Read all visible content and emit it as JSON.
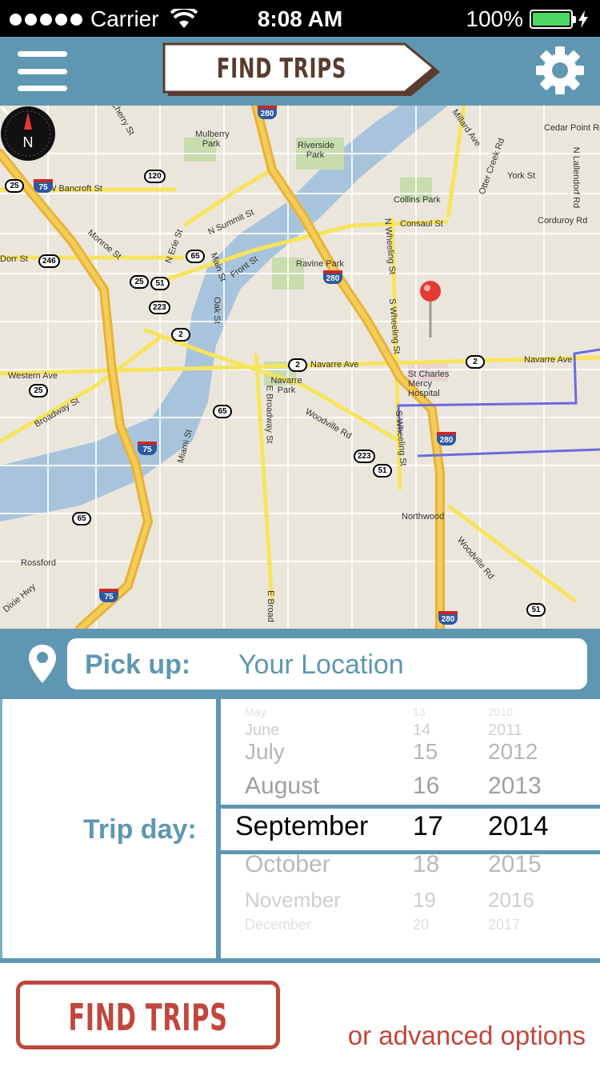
{
  "status_bar": {
    "carrier": "Carrier",
    "time": "8:08 AM",
    "battery": "100%",
    "battery_color": "#4cd964"
  },
  "header": {
    "title": "FIND TRIPS",
    "menu_icon": "hamburger-menu-icon",
    "settings_icon": "gear-icon",
    "bg_color": "#5f97b2",
    "title_color": "#5a3b30"
  },
  "map": {
    "labels": {
      "cherry": "Cherry St",
      "bancroft": "W Bancroft St",
      "mulberry": "Mulberry Park",
      "riverside": "Riverside Park",
      "summit": "N Summit St",
      "monroe": "Monroe St",
      "erie": "N Erie St",
      "dorr": "Dorr St",
      "main": "Main St",
      "front": "Front St",
      "ravine": "Ravine Park",
      "oak": "Oak St",
      "western": "Western Ave",
      "broadway": "Broadway St",
      "navarre_park": "Navarre Park",
      "navarre": "Navarre Ave",
      "navarre2": "Navarre Ave",
      "e_broadway": "E Broadway St",
      "woodville": "Woodville Rd",
      "miami": "Miami St",
      "collins": "Collins Park",
      "consaul": "Consaul St",
      "n_wheeling": "N Wheeling St",
      "s_wheeling": "S Wheeling St",
      "s_wheeling2": "S Wheeling St",
      "st_charles": "St Charles Mercy Hospital",
      "northwood": "Northwood",
      "rossford": "Rossford",
      "dixie": "Dixie Hwy",
      "millard": "Millard Ave",
      "otter_creek": "Otter Creek Rd",
      "cedar_point": "Cedar Point Rd",
      "york": "York St",
      "corduroy": "Corduroy Rd",
      "lallendorf": "N Lallendorf Rd",
      "woodville2": "Woodville Rd",
      "e_broad": "E Broad"
    },
    "shields": [
      "280",
      "120",
      "25",
      "75",
      "246",
      "65",
      "25",
      "51",
      "223",
      "2",
      "280",
      "25",
      "2",
      "65",
      "75",
      "2",
      "223",
      "51",
      "280",
      "65",
      "75",
      "280",
      "51"
    ],
    "compass_label": "N"
  },
  "pickup": {
    "label": "Pick up:",
    "value": "Your Location"
  },
  "trip_day": {
    "label": "Trip day:",
    "months": [
      "May",
      "June",
      "July",
      "August",
      "September",
      "October",
      "November",
      "December"
    ],
    "days": [
      "13",
      "14",
      "15",
      "16",
      "17",
      "18",
      "19",
      "20"
    ],
    "years": [
      "2010",
      "2011",
      "2012",
      "2013",
      "2014",
      "2015",
      "2016",
      "2017"
    ],
    "selected_index": 4
  },
  "actions": {
    "find_trips": "FIND TRIPS",
    "advanced": "or advanced options",
    "accent_color": "#c0473d"
  }
}
